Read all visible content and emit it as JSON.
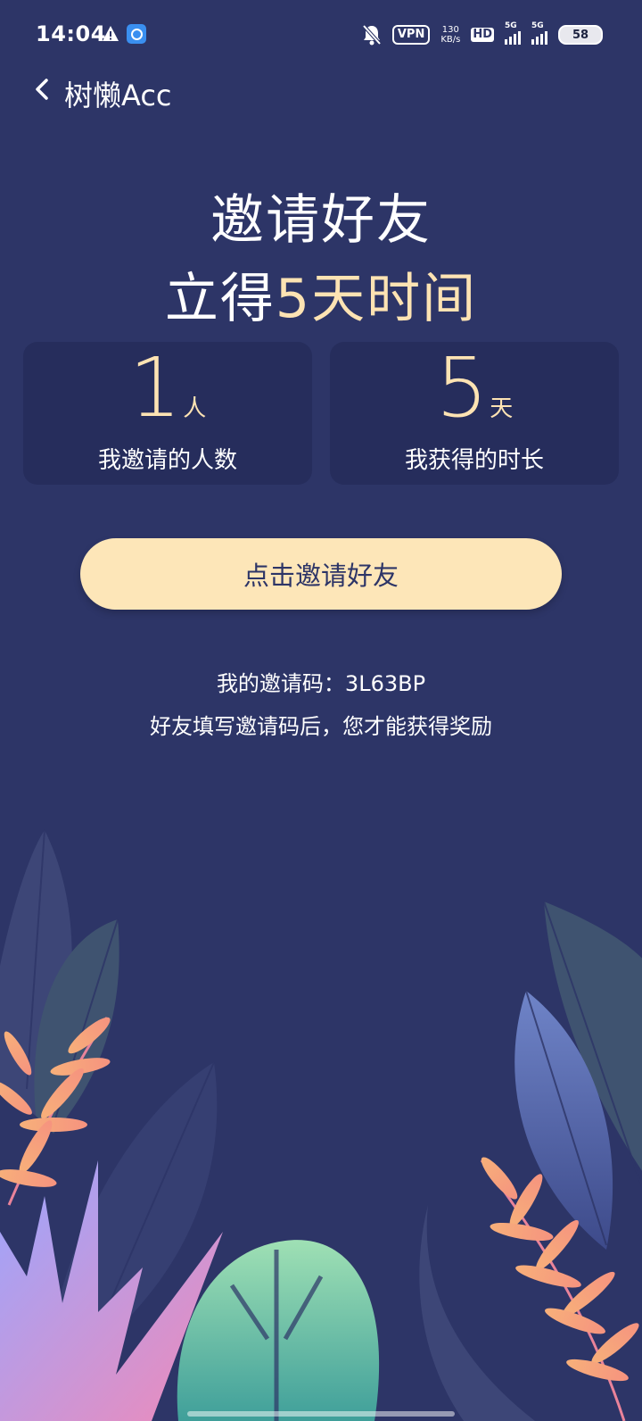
{
  "status_bar": {
    "time": "14:04",
    "vpn": "VPN",
    "net_speed_value": "130",
    "net_speed_unit": "KB/s",
    "hd": "HD",
    "sim1": "5G",
    "sim2": "5G",
    "battery": "58"
  },
  "header": {
    "title": "树懒Acc"
  },
  "headline": {
    "line1": "邀请好友",
    "line2_prefix": "立得",
    "line2_accent": "5天时间"
  },
  "stats": [
    {
      "value": "1",
      "unit": "人",
      "label": "我邀请的人数"
    },
    {
      "value": "5",
      "unit": "天",
      "label": "我获得的时长"
    }
  ],
  "invite_button_label": "点击邀请好友",
  "invite_code_text": "我的邀请码：3L63BP",
  "invite_hint": "好友填写邀请码后，您才能获得奖励",
  "colors": {
    "background": "#2d3567",
    "card": "#262d5c",
    "accent": "#fde3b3",
    "button": "#fde6b8"
  }
}
